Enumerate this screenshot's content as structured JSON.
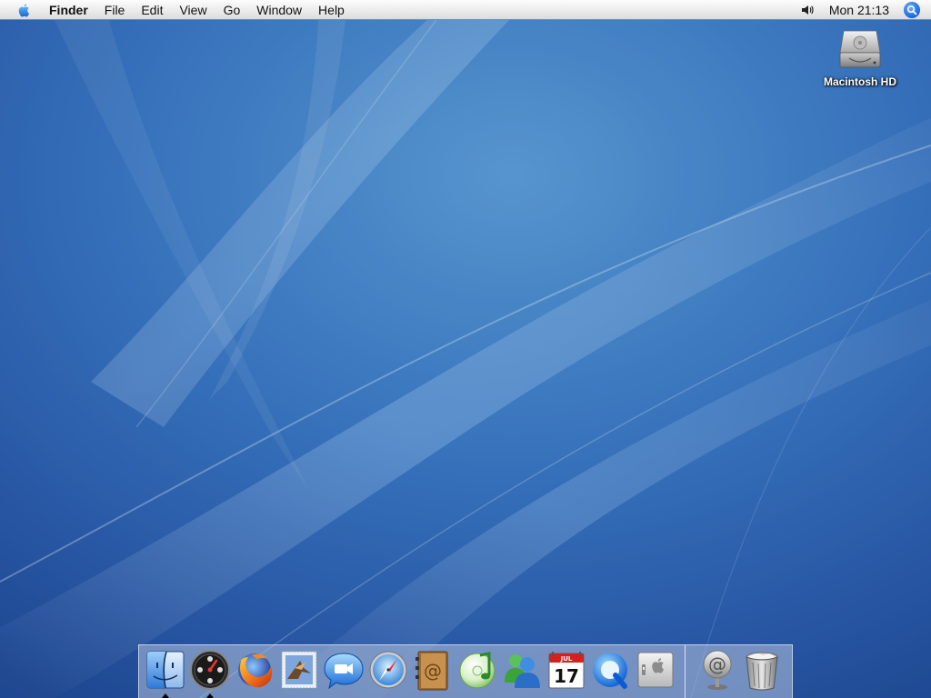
{
  "menubar": {
    "apple_icon": "apple-icon",
    "app_name": "Finder",
    "menus": [
      "File",
      "Edit",
      "View",
      "Go",
      "Window",
      "Help"
    ],
    "volume_icon": "speaker-icon",
    "clock": "Mon 21:13",
    "spotlight_icon": "spotlight-search-icon"
  },
  "desktop": {
    "icons": [
      {
        "label": "Macintosh HD",
        "icon": "hard-drive-icon"
      }
    ]
  },
  "dock": {
    "apps": [
      {
        "name": "Finder",
        "icon": "finder-icon",
        "running": true
      },
      {
        "name": "Dashboard",
        "icon": "dashboard-icon",
        "running": true
      },
      {
        "name": "Firefox",
        "icon": "firefox-icon",
        "running": false
      },
      {
        "name": "Mail",
        "icon": "mail-stamp-icon",
        "running": false
      },
      {
        "name": "iChat",
        "icon": "ichat-icon",
        "running": false
      },
      {
        "name": "Safari",
        "icon": "safari-compass-icon",
        "running": false
      },
      {
        "name": "Address Book",
        "icon": "address-book-icon",
        "running": false
      },
      {
        "name": "iTunes",
        "icon": "itunes-icon",
        "running": false
      },
      {
        "name": "MSN Messenger",
        "icon": "messenger-buddies-icon",
        "running": false
      },
      {
        "name": "iCal",
        "icon": "ical-calendar-icon",
        "calendar_month": "JUL",
        "calendar_day": "17",
        "running": false
      },
      {
        "name": "QuickTime Player",
        "icon": "quicktime-icon",
        "running": false
      },
      {
        "name": "System Preferences",
        "icon": "system-preferences-icon",
        "running": false
      }
    ],
    "extras": [
      {
        "name": "Mail Link",
        "icon": "at-sign-icon"
      },
      {
        "name": "Trash",
        "icon": "trash-icon"
      }
    ]
  },
  "colors": {
    "wallpaper_base": "#2f63ad",
    "wallpaper_light": "#6aa5d8",
    "menubar_bg": "#ececec",
    "spotlight": "#1565d8"
  }
}
